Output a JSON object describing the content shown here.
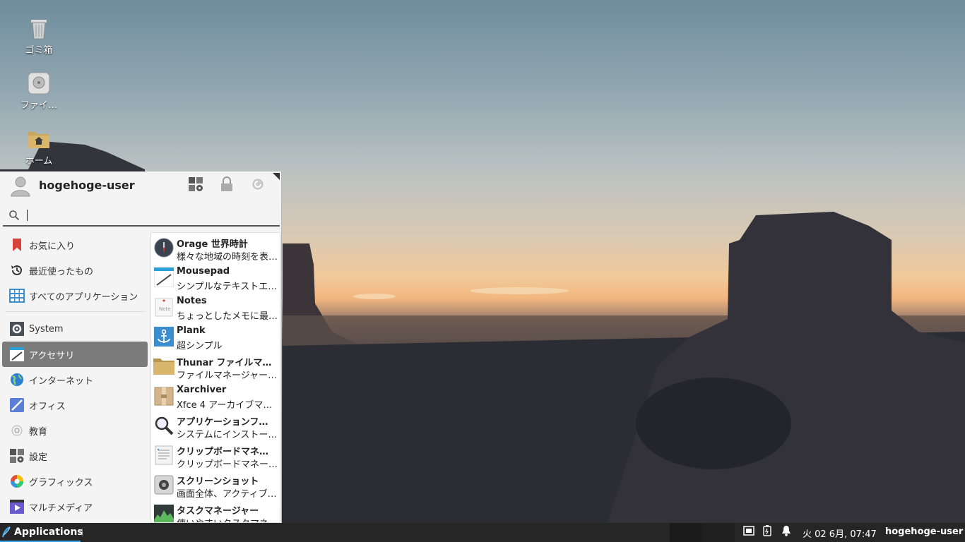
{
  "desktop": {
    "icons": [
      {
        "label": "ゴミ箱",
        "icon": "trash-icon"
      },
      {
        "label": "ファイ…",
        "icon": "filesystem-icon"
      },
      {
        "label": "ホーム",
        "icon": "home-folder-icon"
      }
    ]
  },
  "menu": {
    "username": "hogehoge-user",
    "header_buttons": [
      "settings-manager-icon",
      "lock-icon",
      "logout-icon"
    ],
    "search": {
      "value": "",
      "placeholder": ""
    },
    "categories": [
      {
        "label": "お気に入り",
        "icon": "bookmark-icon",
        "color": "#d6453b"
      },
      {
        "label": "最近使ったもの",
        "icon": "history-icon"
      },
      {
        "label": "すべてのアプリケーション",
        "icon": "grid-icon",
        "color": "#3d8fd1"
      },
      {
        "label": "System",
        "icon": "system-icon"
      },
      {
        "label": "アクセサリ",
        "icon": "accessories-icon",
        "active": true
      },
      {
        "label": "インターネット",
        "icon": "globe-icon",
        "color": "#2d7fd4"
      },
      {
        "label": "オフィス",
        "icon": "office-icon",
        "color": "#5b7fd6"
      },
      {
        "label": "教育",
        "icon": "education-icon"
      },
      {
        "label": "設定",
        "icon": "settings-icon"
      },
      {
        "label": "グラフィックス",
        "icon": "graphics-icon"
      },
      {
        "label": "マルチメディア",
        "icon": "multimedia-icon",
        "color": "#6a5acd"
      }
    ],
    "apps": [
      {
        "name": "Orage 世界時計",
        "desc": "様々な地域の時刻を表…",
        "icon": "clock-icon"
      },
      {
        "name": "Mousepad",
        "desc": "シンプルなテキストエ…",
        "icon": "text-editor-icon"
      },
      {
        "name": "Notes",
        "desc": "ちょっとしたメモに最…",
        "icon": "notes-icon"
      },
      {
        "name": "Plank",
        "desc": "超シンプル",
        "icon": "anchor-icon"
      },
      {
        "name": "Thunar ファイルマ…",
        "desc": "ファイルマネージャー…",
        "icon": "folder-icon"
      },
      {
        "name": "Xarchiver",
        "desc": "Xfce 4 アーカイブマ…",
        "icon": "archive-icon"
      },
      {
        "name": "アプリケーションフ…",
        "desc": "システムにインストー…",
        "icon": "search-icon"
      },
      {
        "name": "クリップボードマネ…",
        "desc": "クリップボードマネー…",
        "icon": "clipboard-icon"
      },
      {
        "name": "スクリーンショット",
        "desc": "画面全体、アクティブ…",
        "icon": "camera-icon"
      },
      {
        "name": "タスクマネージャー",
        "desc": "使いやすいタスクマネ…",
        "icon": "task-manager-icon"
      }
    ]
  },
  "taskbar": {
    "applications_label": "Applications",
    "clock": "火 02  6月, 07:47",
    "user": "hogehoge-user",
    "tray_icons": [
      "network-icon",
      "power-icon",
      "notification-bell-icon"
    ],
    "accent_color": "#3da0e0"
  }
}
